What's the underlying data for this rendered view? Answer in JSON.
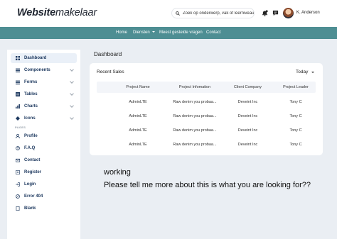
{
  "header": {
    "logo_bold": "Website",
    "logo_light": "makelaar",
    "search_placeholder": "Zoek op onderwerp, vak of leerniveau",
    "username": "K. Anderson"
  },
  "nav": {
    "items": [
      "Home",
      "Diensten",
      "Meest gestelde vragen",
      "Contact"
    ]
  },
  "sidebar": {
    "items": [
      {
        "label": "Dashboard",
        "icon": "dashboard-icon"
      },
      {
        "label": "Components",
        "icon": "components-icon"
      },
      {
        "label": "Forms",
        "icon": "forms-icon"
      },
      {
        "label": "Tables",
        "icon": "tables-icon"
      },
      {
        "label": "Charts",
        "icon": "charts-icon"
      },
      {
        "label": "Icons",
        "icon": "icons-icon"
      }
    ],
    "section": "PAGES",
    "pages": [
      {
        "label": "Profile",
        "icon": "profile-icon"
      },
      {
        "label": "F.A.Q",
        "icon": "faq-icon"
      },
      {
        "label": "Contact",
        "icon": "contact-icon"
      },
      {
        "label": "Register",
        "icon": "register-icon"
      },
      {
        "label": "Login",
        "icon": "login-icon"
      },
      {
        "label": "Error 404",
        "icon": "error-icon"
      },
      {
        "label": "Blank",
        "icon": "blank-icon"
      }
    ]
  },
  "main": {
    "title": "Dashboard",
    "card_title": "Recent Sales",
    "filter": "Today",
    "columns": [
      "Project Name",
      "Project Infomation",
      "Client Company",
      "Project Leader"
    ],
    "rows": [
      [
        "AdminLTE",
        "Raw denim you probaa...",
        "Deveint Inc",
        "Tony C"
      ],
      [
        "AdminLTE",
        "Raw denim you probaa...",
        "Deveint Inc",
        "Tony C"
      ],
      [
        "AdminLTE",
        "Raw denim you probaa...",
        "Deveint Inc",
        "Tony C"
      ],
      [
        "AdminLTE",
        "Raw denim you probaa...",
        "Deveint Inc",
        "Tony C"
      ]
    ]
  },
  "overlay": {
    "line1": "working",
    "line2": "Please tell me more about this is what you are looking for??"
  },
  "colors": {
    "navbar": "#4e8e93",
    "background": "#eaeef3",
    "sidebar_text": "#1f3a60"
  }
}
